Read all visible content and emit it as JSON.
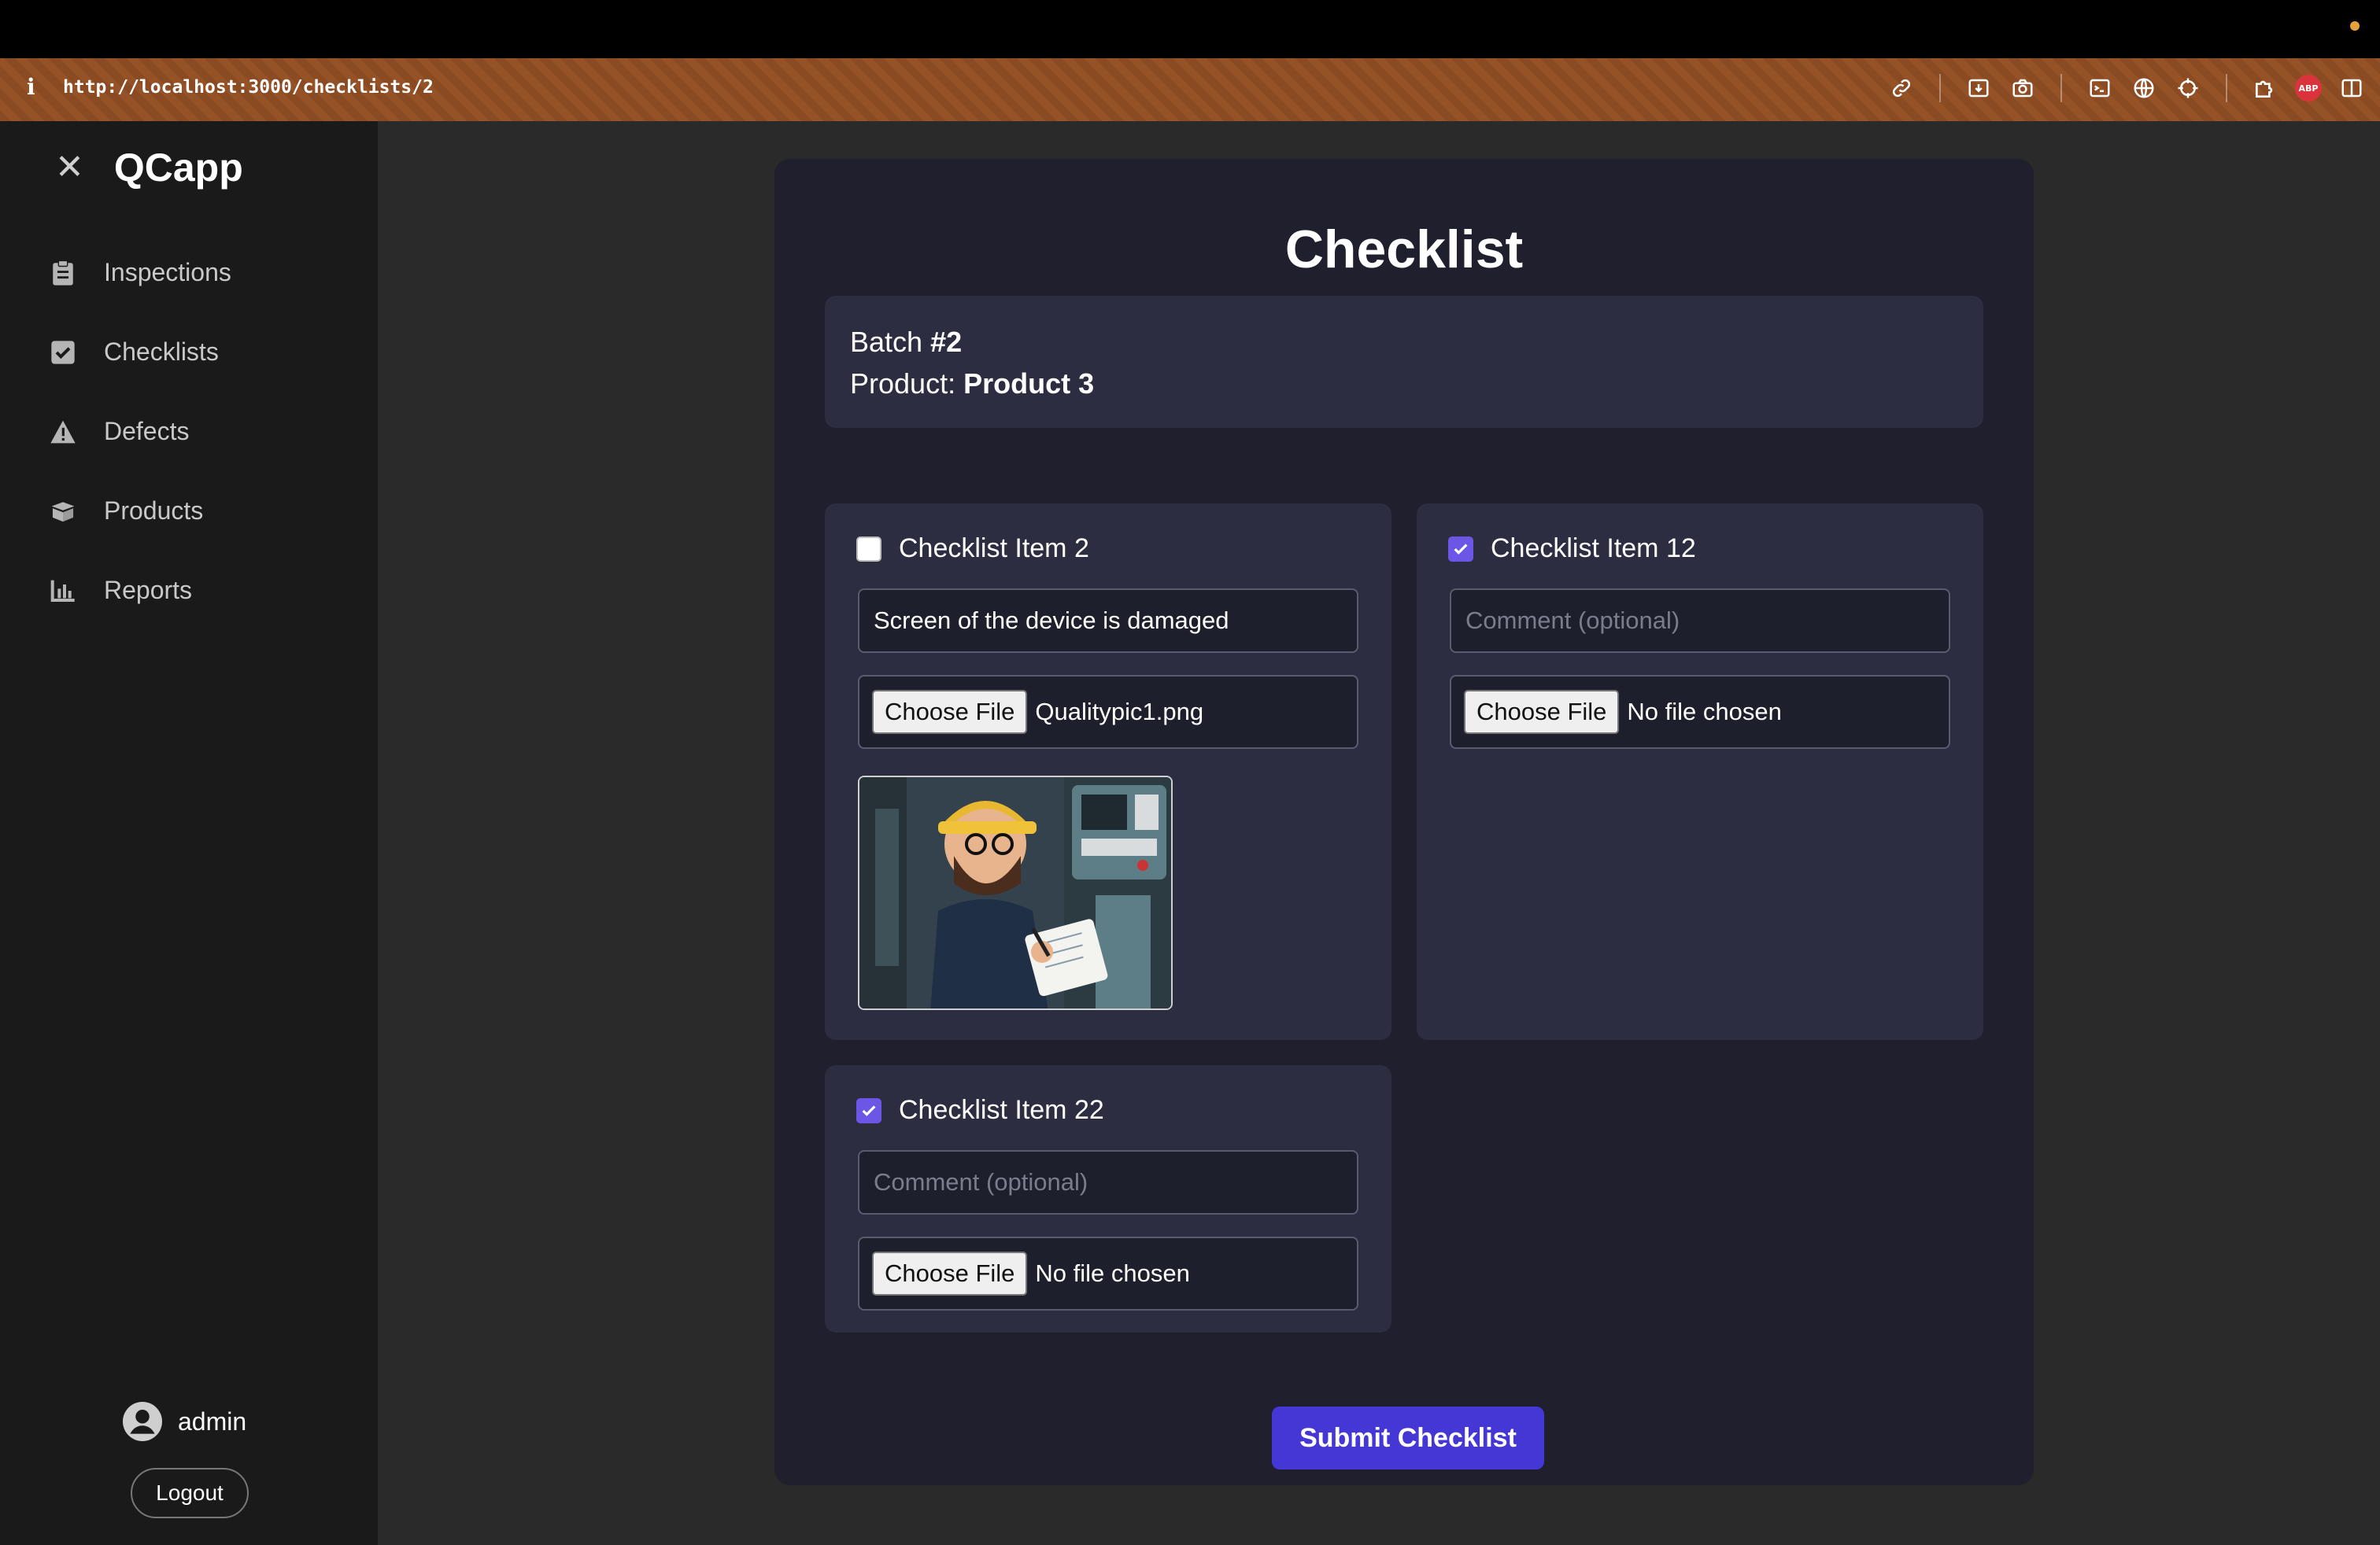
{
  "browser": {
    "url": "http://localhost:3000/checklists/2",
    "info_glyph": "i",
    "adblock_label": "ABP",
    "toolbar_icons": [
      "link-icon",
      "download-icon",
      "camera-icon",
      "terminal-icon",
      "globe-icon",
      "crosshair-icon",
      "puzzle-icon",
      "adblock-icon",
      "sidebar-toggle-icon"
    ]
  },
  "sidebar": {
    "close_glyph": "✕",
    "brand": "QCapp",
    "items": [
      {
        "label": "Inspections",
        "icon": "clipboard-icon"
      },
      {
        "label": "Checklists",
        "icon": "checkbox-icon"
      },
      {
        "label": "Defects",
        "icon": "warning-icon"
      },
      {
        "label": "Products",
        "icon": "box-icon"
      },
      {
        "label": "Reports",
        "icon": "bar-chart-icon"
      }
    ],
    "user": "admin",
    "logout": "Logout"
  },
  "main": {
    "title": "Checklist",
    "batch_label": "Batch ",
    "batch_value": "#2",
    "product_label": "Product: ",
    "product_value": "Product 3",
    "choose_file": "Choose File",
    "items": [
      {
        "title": "Checklist Item 2",
        "checked": false,
        "comment": "Screen of the device is damaged",
        "file": "Qualitypic1.png"
      },
      {
        "title": "Checklist Item 12",
        "checked": true,
        "comment": "",
        "comment_placeholder": "Comment (optional)",
        "file": "No file chosen"
      },
      {
        "title": "Checklist Item 22",
        "checked": true,
        "comment": "",
        "comment_placeholder": "Comment (optional)",
        "file": "No file chosen"
      }
    ],
    "submit": "Submit Checklist"
  },
  "colors": {
    "accent": "#4536d6",
    "checkbox": "#6c56e6",
    "card": "#1f1f2e",
    "panel": "#2d2d42",
    "sidebar": "#1a1a1a"
  }
}
